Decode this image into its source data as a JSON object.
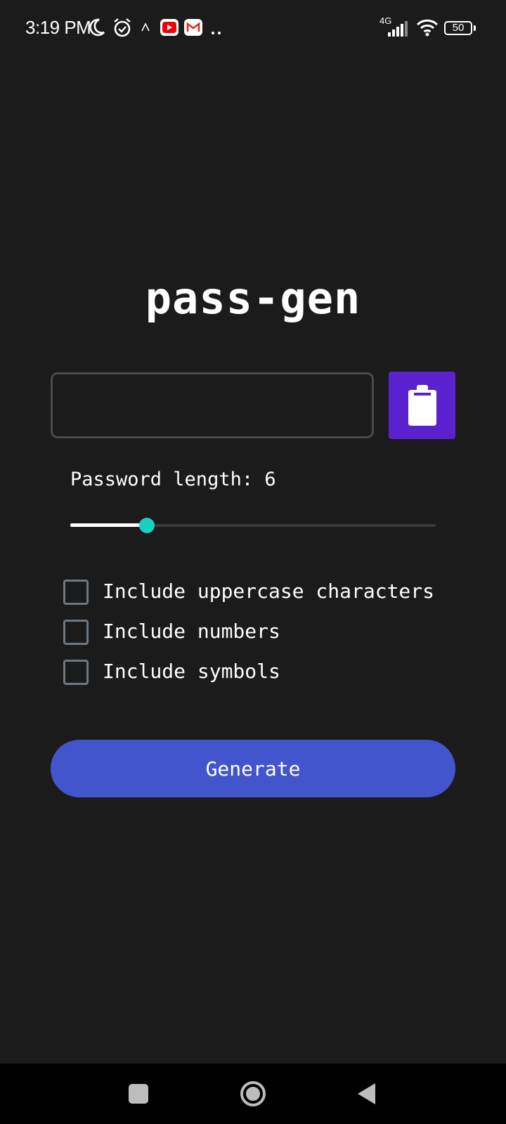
{
  "status_bar": {
    "time": "3:19 PM",
    "network": "4G",
    "battery": "50",
    "notification_icons": [
      "moon-icon",
      "alarm-icon",
      "app-notification-icon",
      "youtube-icon",
      "gmail-icon",
      "more-dots-icon"
    ],
    "system_icons": [
      "signal-icon",
      "wifi-icon",
      "battery-icon"
    ]
  },
  "app": {
    "title": "pass-gen"
  },
  "password_field": {
    "value": "",
    "placeholder": ""
  },
  "copy_button": {
    "icon": "clipboard-icon",
    "color": "#5a22cf"
  },
  "length": {
    "label": "Password length: 6",
    "value": 6,
    "fraction": 0.21
  },
  "options": [
    {
      "label": "Include uppercase characters",
      "checked": false
    },
    {
      "label": "Include numbers",
      "checked": false
    },
    {
      "label": "Include symbols",
      "checked": false
    }
  ],
  "generate_button": {
    "label": "Generate",
    "color": "#4255cc"
  },
  "nav_bar": {
    "items": [
      "recents-icon",
      "home-icon",
      "back-icon"
    ]
  },
  "colors": {
    "background": "#1b1b1b",
    "slider_thumb": "#19d1c1",
    "checkbox_border": "#6c7884"
  }
}
